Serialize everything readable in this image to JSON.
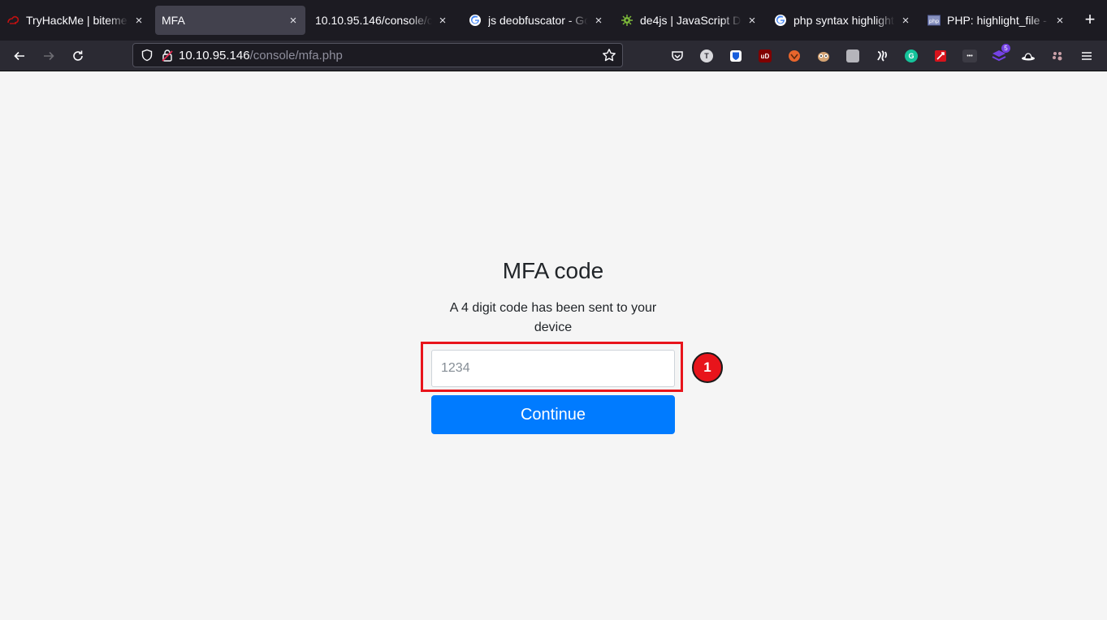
{
  "browser": {
    "tabs": [
      {
        "title": "TryHackMe | biteme",
        "favicon": "tryhackme-icon",
        "active": false
      },
      {
        "title": "MFA",
        "favicon": "none",
        "active": true
      },
      {
        "title": "10.10.95.146/console/co",
        "favicon": "none",
        "active": false
      },
      {
        "title": "js deobfuscator - Go",
        "favicon": "google-icon",
        "active": false
      },
      {
        "title": "de4js | JavaScript De",
        "favicon": "de4js-icon",
        "active": false
      },
      {
        "title": "php syntax highlight",
        "favicon": "google-icon",
        "active": false
      },
      {
        "title": "PHP: highlight_file -",
        "favicon": "php-icon",
        "active": false
      }
    ],
    "close_glyph": "×",
    "new_tab_glyph": "+",
    "url": {
      "host": "10.10.95.146",
      "path": "/console/mfa.php"
    },
    "extensions": [
      {
        "name": "pocket-icon"
      },
      {
        "name": "tampermonkey-icon",
        "label": "T"
      },
      {
        "name": "bitwarden-icon"
      },
      {
        "name": "ublock-icon",
        "label": "uD"
      },
      {
        "name": "foxyproxy-icon"
      },
      {
        "name": "owl-icon"
      },
      {
        "name": "cookie-editor-icon"
      },
      {
        "name": "wappalyzer-icon"
      },
      {
        "name": "grammarly-icon",
        "label": "G"
      },
      {
        "name": "hacktools-icon"
      },
      {
        "name": "more-dots-icon",
        "label": "•••"
      },
      {
        "name": "container-icon",
        "badge": "5"
      },
      {
        "name": "hat-icon"
      },
      {
        "name": "paw-icon"
      }
    ],
    "accent": "#42414d"
  },
  "page": {
    "title": "MFA code",
    "description": "A 4 digit code has been sent to your device",
    "code_input": {
      "placeholder": "1234",
      "value": ""
    },
    "continue_label": "Continue",
    "annotation_number": "1",
    "colors": {
      "button": "#007bff",
      "highlight": "#e8141b",
      "background": "#f5f5f5"
    }
  }
}
